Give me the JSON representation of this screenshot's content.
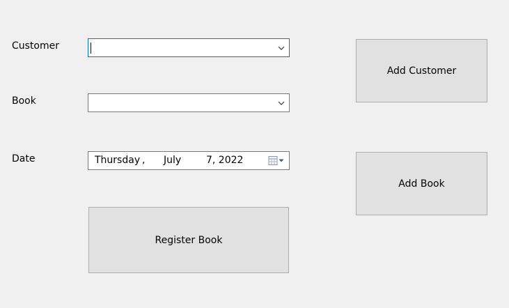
{
  "labels": {
    "customer": "Customer",
    "book": "Book",
    "date": "Date"
  },
  "customer_combo": {
    "value": ""
  },
  "book_combo": {
    "value": ""
  },
  "date_picker": {
    "weekday": "Thursday",
    "sep": ",",
    "month": "July",
    "day_year": "7, 2022"
  },
  "buttons": {
    "register": "Register Book",
    "add_customer": "Add Customer",
    "add_book": "Add Book"
  },
  "colors": {
    "background": "#f0f0f0",
    "focus_border": "#0078d7",
    "button_face": "#e1e1e1"
  },
  "icons": {
    "dropdown": "chevron-down-icon",
    "calendar": "calendar-icon"
  }
}
